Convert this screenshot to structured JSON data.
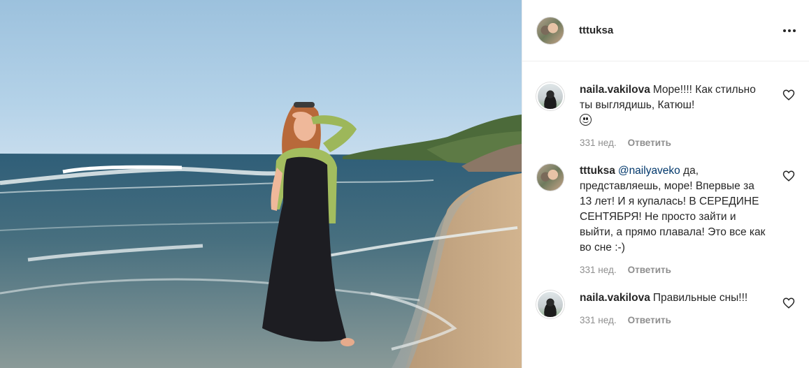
{
  "post": {
    "author": "tttuksa",
    "more_icon": "more-horizontal-icon"
  },
  "comments": [
    {
      "username": "naila.vakilova",
      "text": "Море!!!! Как стильно ты выглядишь, Катюш!",
      "emoji": "smiling-face-emoji",
      "age": "331 нед.",
      "reply_label": "Ответить",
      "like_icon": "heart-icon"
    },
    {
      "username": "tttuksa",
      "mention": "@nailyaveko",
      "text": "да, представляешь, море! Впервые за 13 лет! И я купалась! В СЕРЕДИНЕ СЕНТЯБРЯ! Не просто зайти и выйти, а прямо плавала! Это все как во сне :-)",
      "age": "331 нед.",
      "reply_label": "Ответить",
      "like_icon": "heart-icon"
    },
    {
      "username": "naila.vakilova",
      "text": "Правильные сны!!!",
      "age": "331 нед.",
      "reply_label": "Ответить",
      "like_icon": "heart-icon"
    }
  ]
}
